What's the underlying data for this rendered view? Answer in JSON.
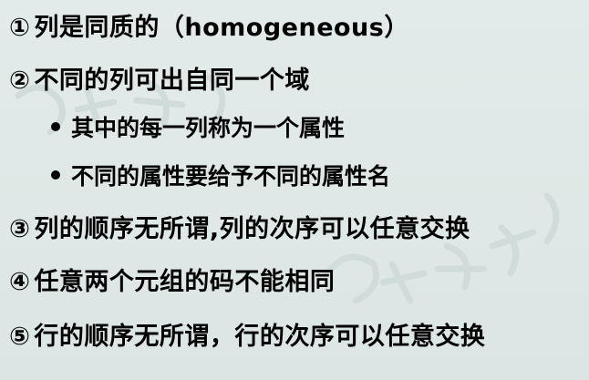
{
  "lines": [
    {
      "num": "①",
      "text": "列是同质的（homogeneous）"
    },
    {
      "num": "②",
      "text": "不同的列可出自同一个域"
    },
    {
      "num": "③",
      "text": "列的顺序无所谓,列的次序可以任意交换"
    },
    {
      "num": "④",
      "text": "任意两个元组的码不能相同"
    },
    {
      "num": "⑤",
      "text": "行的顺序无所谓，行的次序可以任意交换"
    }
  ],
  "sub_bullets": [
    {
      "text": "其中的每一列称为一个属性"
    },
    {
      "text": "不同的属性要给予不同的属性名"
    }
  ],
  "colors": {
    "background": "#dfe8e6",
    "text": "#000000",
    "watermark": "#cfdcda"
  }
}
